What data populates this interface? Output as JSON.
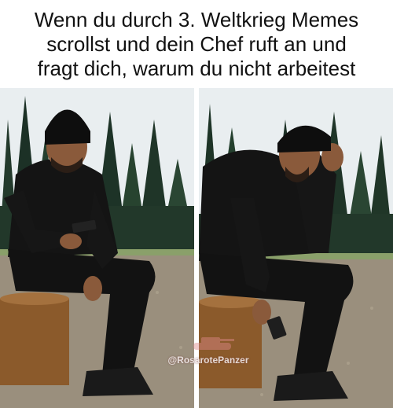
{
  "caption": {
    "line1": "Wenn du durch 3. Weltkrieg Memes",
    "line2": "scrollst und dein Chef ruft an und",
    "line3": "fragt dich, warum du nicht arbeitest"
  },
  "watermark": "@RosarotePanzer",
  "colors": {
    "sky": "#e9eef0",
    "trees": "#1f3327",
    "ground": "#9a8f7d",
    "clothing": "#111111",
    "stump": "#8b5a2b",
    "skin": "#8a5a3b"
  }
}
